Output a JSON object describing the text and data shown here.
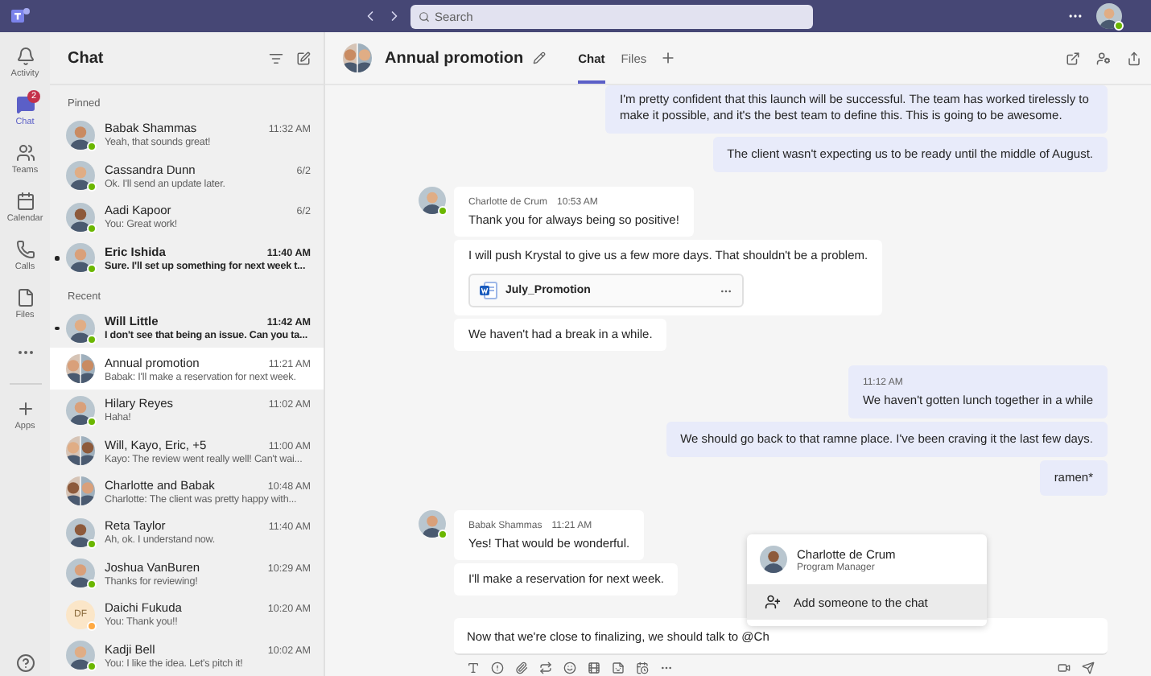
{
  "top_bar": {
    "search": {
      "placeholder": "Search"
    },
    "user": {
      "color": "#6bb700"
    }
  },
  "rail": [
    {
      "label": "Activity",
      "selected": false
    },
    {
      "label": "Chat",
      "selected": true,
      "badge": "2"
    },
    {
      "label": "Teams",
      "selected": false
    },
    {
      "label": "Calendar",
      "selected": false
    },
    {
      "label": "Calls",
      "selected": false
    },
    {
      "label": "Files",
      "selected": false
    },
    {
      "selected": false
    },
    {
      "label": "Apps",
      "selected": false
    }
  ],
  "chat_list": {
    "title": "Chat",
    "sections": [
      {
        "label": "Pinned",
        "items": [
          {
            "name": "Babak Shammas",
            "time": "11:32 AM",
            "preview": "Yeah, that sounds great!",
            "unread": false,
            "selected": false,
            "kind": "person",
            "color": "#6bb700"
          },
          {
            "name": "Cassandra Dunn",
            "time": "6/2",
            "preview": "Ok. I'll send an update later.",
            "unread": false,
            "selected": false,
            "kind": "person",
            "color": "#6bb700"
          },
          {
            "name": "Aadi Kapoor",
            "time": "6/2",
            "preview": "You: Great work!",
            "unread": false,
            "selected": false,
            "kind": "person",
            "color": "#6bb700"
          },
          {
            "name": "Eric Ishida",
            "time": "11:40 AM",
            "preview": "Sure. I'll set up something for next week t...",
            "unread": true,
            "selected": false,
            "kind": "person",
            "color": "#6bb700"
          }
        ]
      },
      {
        "label": "Recent",
        "items": [
          {
            "name": "Will Little",
            "time": "11:42 AM",
            "preview": "I don't see that being an issue. Can you ta...",
            "unread": true,
            "selected": false,
            "kind": "person",
            "color": "#6bb700"
          },
          {
            "name": "Annual promotion",
            "time": "11:21 AM",
            "preview": "Babak: I'll make a reservation for next week.",
            "unread": false,
            "selected": true,
            "kind": "group"
          },
          {
            "name": "Hilary Reyes",
            "time": "11:02 AM",
            "preview": "Haha!",
            "unread": false,
            "selected": false,
            "kind": "person",
            "color": "#6bb700"
          },
          {
            "name": "Will, Kayo, Eric, +5",
            "time": "11:00 AM",
            "preview": "Kayo: The review went really well! Can't wai...",
            "unread": false,
            "selected": false,
            "kind": "group"
          },
          {
            "name": "Charlotte and Babak",
            "time": "10:48 AM",
            "preview": "Charlotte: The client was pretty happy with...",
            "unread": false,
            "selected": false,
            "kind": "group"
          },
          {
            "name": "Reta Taylor",
            "time": "11:40 AM",
            "preview": "Ah, ok. I understand now.",
            "unread": false,
            "selected": false,
            "kind": "person",
            "color": "#6bb700"
          },
          {
            "name": "Joshua VanBuren",
            "time": "10:29 AM",
            "preview": "Thanks for reviewing!",
            "unread": false,
            "selected": false,
            "kind": "person",
            "color": "#6bb700"
          },
          {
            "name": "Daichi Fukuda",
            "time": "10:20 AM",
            "preview": "You: Thank you!!",
            "unread": false,
            "selected": false,
            "kind": "initials",
            "initials": "DF",
            "color": "#ffaa44"
          },
          {
            "name": "Kadji Bell",
            "time": "10:02 AM",
            "preview": "You: I like the idea. Let's pitch it!",
            "unread": false,
            "selected": false,
            "kind": "person",
            "color": "#6bb700"
          }
        ]
      }
    ]
  },
  "conversation": {
    "title": "Annual promotion",
    "tabs": [
      {
        "label": "Chat",
        "selected": true
      },
      {
        "label": "Files",
        "selected": false
      }
    ],
    "groups": [
      {
        "kind": "mine",
        "bubbles": [
          {
            "text": "I'm pretty confident that this launch will be successful. The team has worked tirelessly to make it possible, and it's the best team to define this. This is going to be awesome."
          },
          {
            "text": "The client wasn't expecting us to be ready until the middle of August."
          }
        ]
      },
      {
        "kind": "theirs",
        "sender": "Charlotte de Crum",
        "time": "10:53 AM",
        "color": "#6bb700",
        "bubbles": [
          {
            "text": "Thank you for always being so positive!"
          },
          {
            "text": "I will push Krystal to give us a few more days. That shouldn't be a problem.",
            "attachment": "July_Promotion"
          },
          {
            "text": "We haven't had a break in a while."
          }
        ]
      },
      {
        "kind": "mine",
        "time": "11:12 AM",
        "bubbles": [
          {
            "text": "We haven't gotten lunch together in a while"
          },
          {
            "text": "We should go back to that ramne place. I've been craving it the last few days."
          },
          {
            "text": "ramen*"
          }
        ]
      },
      {
        "kind": "theirs",
        "sender": "Babak Shammas",
        "time": "11:21 AM",
        "color": "#6bb700",
        "bubbles": [
          {
            "text": "Yes! That would be wonderful."
          },
          {
            "text": "I'll make a reservation for next week."
          }
        ]
      }
    ],
    "composer": {
      "value": "Now that we're close to finalizing, we should talk to @Ch"
    },
    "mention_popup": {
      "suggestions": [
        {
          "name": "Charlotte de Crum",
          "role": "Program Manager"
        }
      ],
      "action": "Add someone to the chat"
    }
  }
}
